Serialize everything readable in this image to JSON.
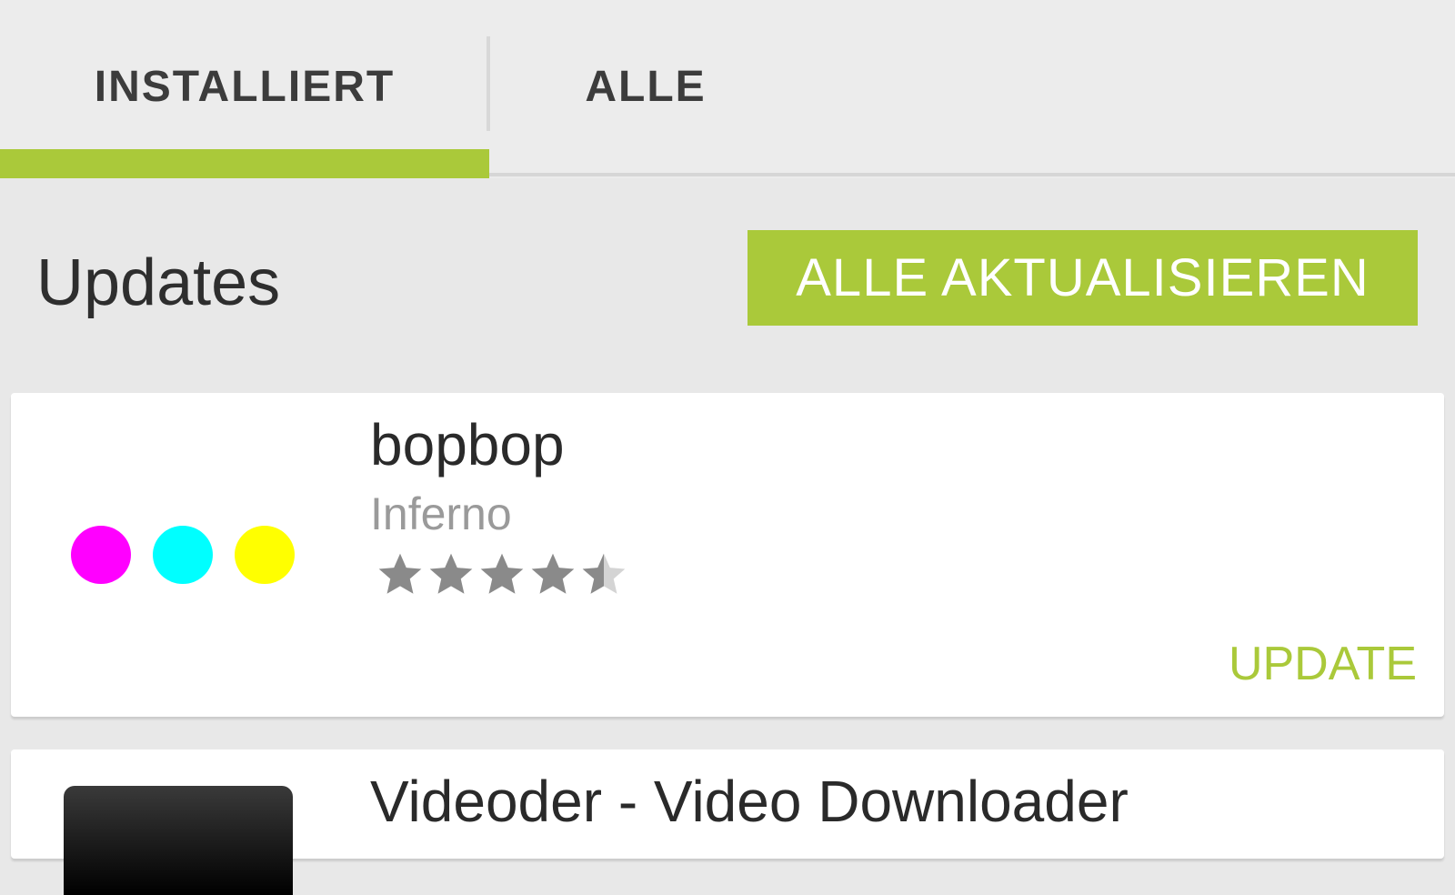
{
  "tabs": [
    {
      "label": "INSTALLIERT",
      "active": true
    },
    {
      "label": "ALLE",
      "active": false
    }
  ],
  "section": {
    "title": "Updates",
    "update_all_label": "ALLE AKTUALISIEREN"
  },
  "apps": [
    {
      "name": "bopbop",
      "developer": "Inferno",
      "rating": 4.5,
      "action_label": "UPDATE",
      "icon": "three-color-dots-icon"
    },
    {
      "name": "Videoder - Video Downloader",
      "icon": "videoder-icon"
    }
  ],
  "colors": {
    "accent": "#aac93a",
    "background": "#e8e8e8",
    "star": "#8a8a8a"
  }
}
